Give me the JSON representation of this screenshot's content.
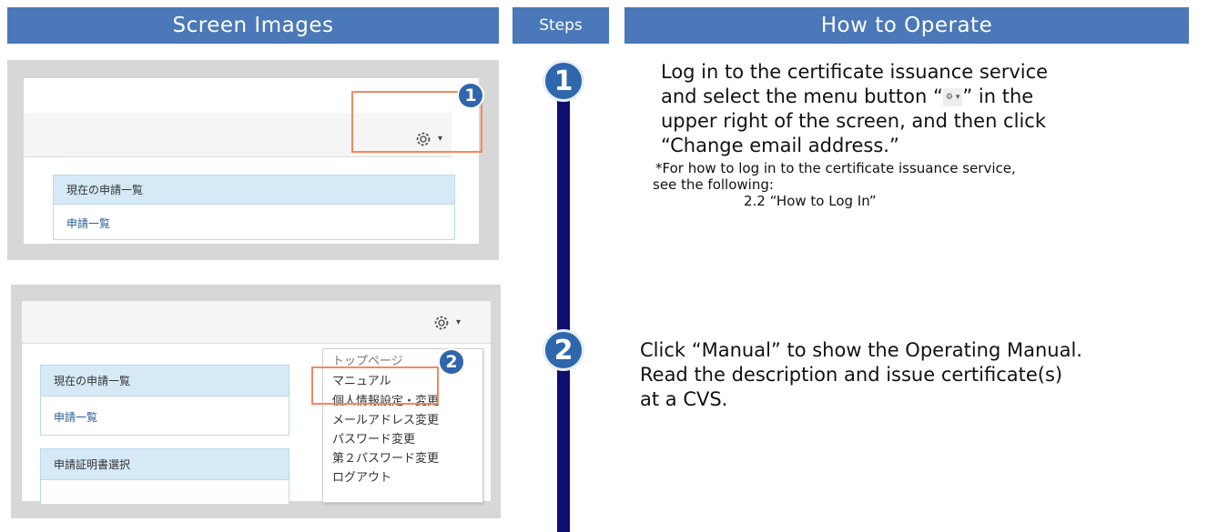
{
  "headers": {
    "screen_images": "Screen Images",
    "steps": "Steps",
    "how_to_operate": "How to Operate"
  },
  "screen1": {
    "panel_title": "現在の申請一覧",
    "panel_link": "申請一覧",
    "badge": "1",
    "caret": "▾",
    "gear_icon": "gear-icon"
  },
  "screen2": {
    "panel1_title": "現在の申請一覧",
    "panel1_link": "申請一覧",
    "panel2_title": "申請証明書選択",
    "badge": "2",
    "caret": "▾",
    "gear_icon": "gear-icon",
    "menu": [
      "トップページ",
      "マニュアル",
      "個人情報設定・変更",
      "メールアドレス変更",
      "パスワード変更",
      "第２パスワード変更",
      "ログアウト"
    ]
  },
  "steps": [
    {
      "number": "1",
      "line1": "Log in to the certificate issuance service",
      "line2_a": "and select the menu button “",
      "line2_b": "” in the",
      "line3": "upper right of the screen, and then click",
      "line4": "“Change email address.”",
      "note1": "*For how to log in to the certificate issuance service,",
      "note2": "see the following:",
      "note3": "2.2 “How to Log In”"
    },
    {
      "number": "2",
      "line1": "Click “Manual” to show the Operating Manual.",
      "line2": "Read the description and issue certificate(s)",
      "line3": "at a CVS."
    }
  ],
  "colors": {
    "header_blue": "#4a78b8",
    "step_blue": "#2f66ac",
    "step_line": "#0e0e6e",
    "highlight": "#f08a5d"
  }
}
